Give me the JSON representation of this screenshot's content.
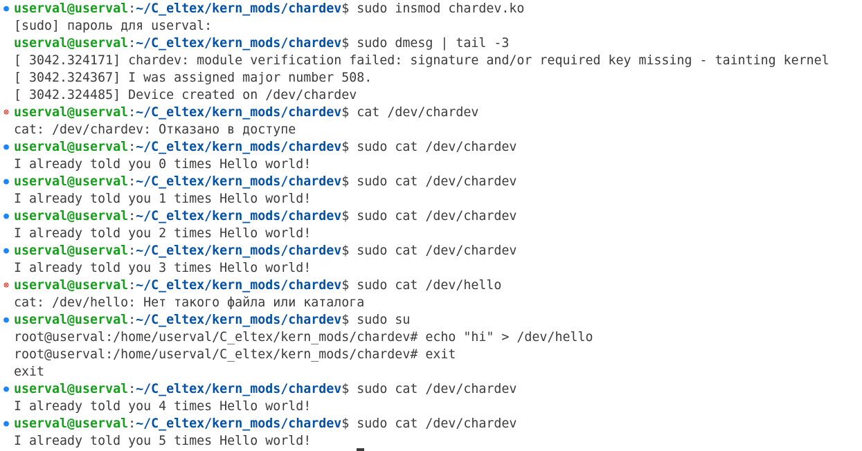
{
  "prompt": {
    "user": "userval@userval",
    "colon": ":",
    "path": "~/C_eltex/kern_mods/chardev",
    "dollar": "$ "
  },
  "lines": [
    {
      "kind": "prompt",
      "mark": "ok",
      "command": "sudo insmod chardev.ko"
    },
    {
      "kind": "output",
      "text": "[sudo] пароль для userval:"
    },
    {
      "kind": "prompt",
      "mark": "none",
      "command": "sudo dmesg | tail -3"
    },
    {
      "kind": "output",
      "text": "[ 3042.324171] chardev: module verification failed: signature and/or required key missing - tainting kernel"
    },
    {
      "kind": "output",
      "text": "[ 3042.324367] I was assigned major number 508."
    },
    {
      "kind": "output",
      "text": "[ 3042.324485] Device created on /dev/chardev"
    },
    {
      "kind": "prompt",
      "mark": "err",
      "command": "cat /dev/chardev"
    },
    {
      "kind": "output",
      "text": "cat: /dev/chardev: Отказано в доступе"
    },
    {
      "kind": "prompt",
      "mark": "ok",
      "command": "sudo cat /dev/chardev"
    },
    {
      "kind": "output",
      "text": "I already told you 0 times Hello world!"
    },
    {
      "kind": "prompt",
      "mark": "ok",
      "command": "sudo cat /dev/chardev"
    },
    {
      "kind": "output",
      "text": "I already told you 1 times Hello world!"
    },
    {
      "kind": "prompt",
      "mark": "ok",
      "command": "sudo cat /dev/chardev"
    },
    {
      "kind": "output",
      "text": "I already told you 2 times Hello world!"
    },
    {
      "kind": "prompt",
      "mark": "ok",
      "command": "sudo cat /dev/chardev"
    },
    {
      "kind": "output",
      "text": "I already told you 3 times Hello world!"
    },
    {
      "kind": "prompt",
      "mark": "err",
      "command": "sudo cat /dev/hello"
    },
    {
      "kind": "output",
      "text": "cat: /dev/hello: Нет такого файла или каталога"
    },
    {
      "kind": "prompt",
      "mark": "ok",
      "command": "sudo su"
    },
    {
      "kind": "output",
      "text": "root@userval:/home/userval/C_eltex/kern_mods/chardev# echo \"hi\" > /dev/hello"
    },
    {
      "kind": "output",
      "text": "root@userval:/home/userval/C_eltex/kern_mods/chardev# exit"
    },
    {
      "kind": "output",
      "text": "exit"
    },
    {
      "kind": "prompt",
      "mark": "ok",
      "command": "sudo cat /dev/chardev"
    },
    {
      "kind": "output",
      "text": "I already told you 4 times Hello world!"
    },
    {
      "kind": "prompt",
      "mark": "ok",
      "command": "sudo cat /dev/chardev"
    },
    {
      "kind": "output",
      "text": "I already told you 5 times Hello world!"
    }
  ],
  "marks": {
    "ok": "●",
    "err": "⊗"
  },
  "colors": {
    "background": "#ffffff",
    "text": "#3b3b3b",
    "user": "#14a01a",
    "path": "#0451a5",
    "mark_ok": "#1a85ff",
    "mark_err": "#e51400"
  }
}
